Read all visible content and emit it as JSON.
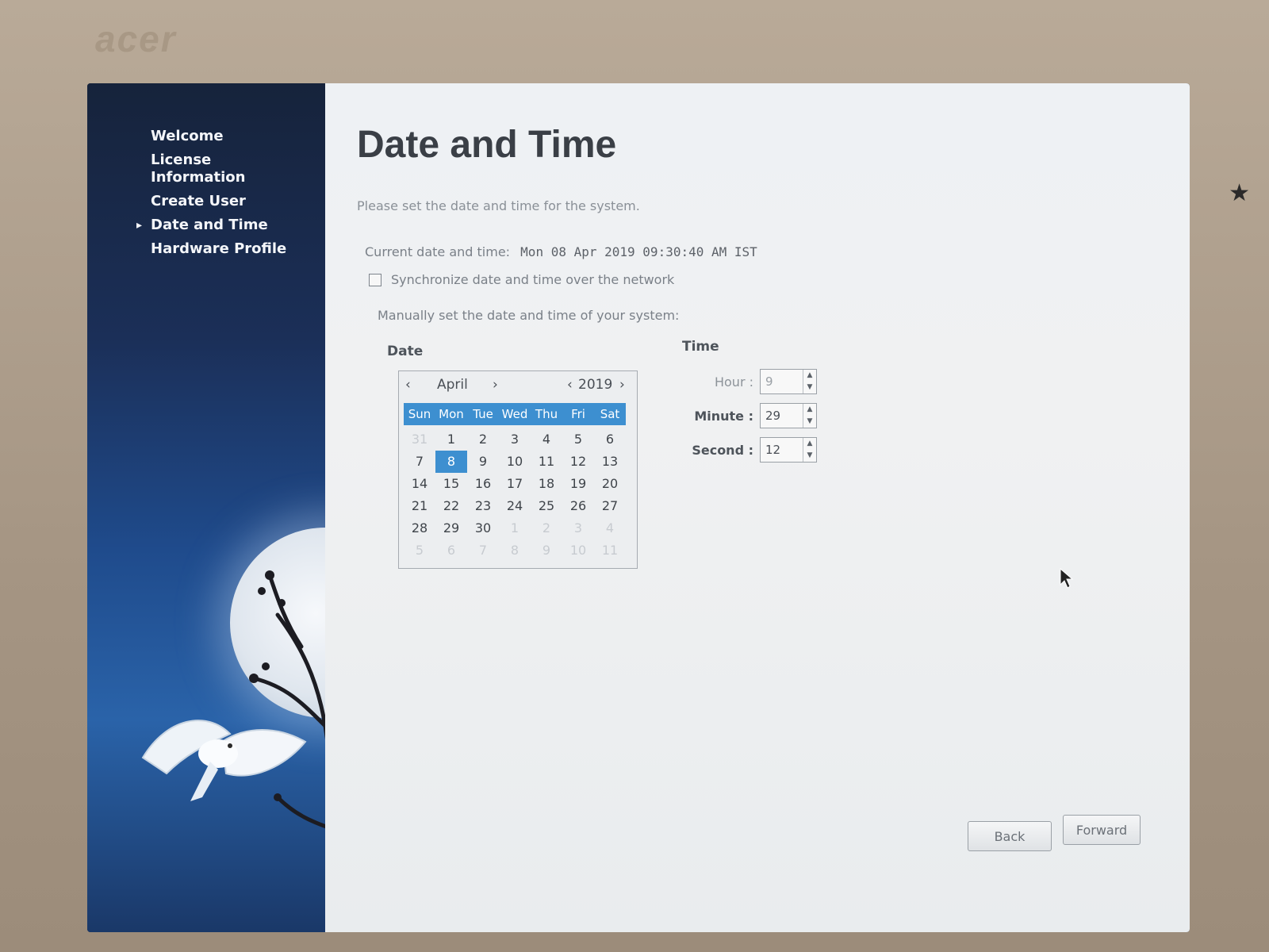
{
  "bezel": {
    "brand": "acer"
  },
  "sidebar": {
    "items": [
      {
        "label": "Welcome",
        "active": false
      },
      {
        "label": "License Information",
        "active": false
      },
      {
        "label": "Create User",
        "active": false
      },
      {
        "label": "Date and Time",
        "active": true
      },
      {
        "label": "Hardware Profile",
        "active": false
      }
    ]
  },
  "main": {
    "title": "Date and Time",
    "subtitle": "Please set the date and time for the system.",
    "current_label": "Current date and time:",
    "current_value": "Mon 08 Apr 2019 09:30:40 AM IST",
    "sync_label": "Synchronize date and time over the network",
    "sync_checked": false,
    "manual_label": "Manually set the date and time of your system:",
    "date_label": "Date",
    "time_label": "Time"
  },
  "calendar": {
    "prev_month": "‹",
    "month": "April",
    "next_month": "›",
    "prev_year": "‹",
    "year": "2019",
    "next_year": "›",
    "weekdays": [
      "Sun",
      "Mon",
      "Tue",
      "Wed",
      "Thu",
      "Fri",
      "Sat"
    ],
    "selected": "8",
    "days": [
      "31",
      "1",
      "2",
      "3",
      "4",
      "5",
      "6",
      "7",
      "8",
      "9",
      "10",
      "11",
      "12",
      "13",
      "14",
      "15",
      "16",
      "17",
      "18",
      "19",
      "20",
      "21",
      "22",
      "23",
      "24",
      "25",
      "26",
      "27",
      "28",
      "29",
      "30",
      "1",
      "2",
      "3",
      "4",
      "5",
      "6",
      "7",
      "8",
      "9",
      "10",
      "11"
    ]
  },
  "time": {
    "hour_label": "Hour :",
    "hour": "9",
    "minute_label": "Minute :",
    "minute": "29",
    "second_label": "Second :",
    "second": "12"
  },
  "footer": {
    "back": "Back",
    "forward": "Forward"
  },
  "colors": {
    "accent": "#3d8fd0",
    "sidebar": "#1f4b8c"
  }
}
